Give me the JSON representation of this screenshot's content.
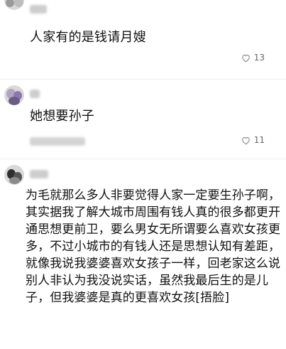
{
  "comments": [
    {
      "username": "",
      "text": "人家有的是钱请月嫂",
      "likes": "13",
      "meta": ""
    },
    {
      "username": "",
      "text": "她想要孙子",
      "likes": "11",
      "meta": ""
    },
    {
      "username": "",
      "text": "为毛就那么多人非要觉得人家一定要生孙子啊，其实据我了解大城市周围有钱人真的很多都更开通思想更前卫，要么男女无所谓要么喜欢女孩更多，不过小城市的有钱人还是思想认知有差距，就像我说我婆婆喜欢女孩子一样，回老家这么说别人非认为我没说实话，虽然我最后生的是儿子，但我婆婆是真的更喜欢女孩[捂脸]"
    }
  ],
  "icons": {
    "like": "heart-outline-icon"
  },
  "colors": {
    "text": "#111111",
    "muted": "#666666",
    "divider": "#efefef"
  }
}
